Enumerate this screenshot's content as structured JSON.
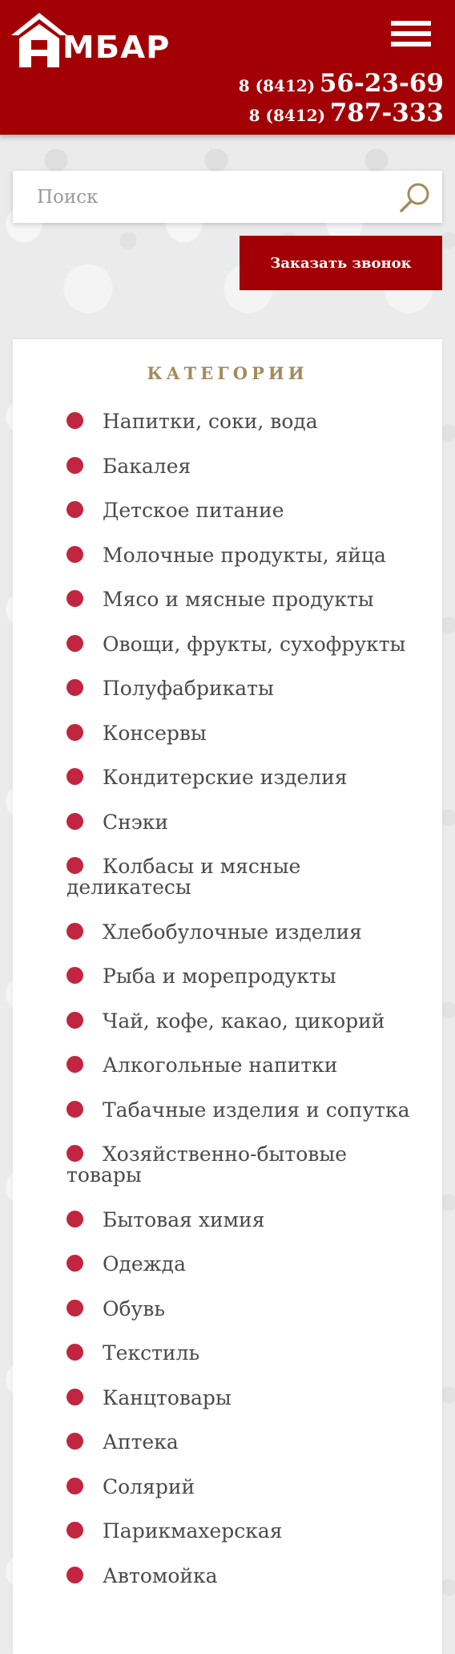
{
  "header": {
    "logo_text": "МБАР",
    "phones": [
      {
        "code": "8 (8412)",
        "number": "56-23-69"
      },
      {
        "code": "8 (8412)",
        "number": "787-333"
      }
    ]
  },
  "search": {
    "placeholder": "Поиск"
  },
  "callback": {
    "label": "Заказать звонок"
  },
  "categories": {
    "title": "КАТЕГОРИИ",
    "items": [
      "Напитки, соки, вода",
      "Бакалея",
      "Детское питание",
      "Молочные продукты, яйца",
      "Мясо и мясные продукты",
      "Овощи, фрукты, сухофрукты",
      "Полуфабрикаты",
      "Консервы",
      "Кондитерские изделия",
      "Снэки",
      "Колбасы и мясные деликатесы",
      "Хлебобулочные изделия",
      "Рыба и морепродукты",
      "Чай, кофе, какао, цикорий",
      "Алкогольные напитки",
      "Табачные изделия и сопутка",
      "Хозяйственно-бытовые товары",
      "Бытовая химия",
      "Одежда",
      "Обувь",
      "Текстиль",
      "Канцтовары",
      "Аптека",
      "Солярий",
      "Парикмахерская",
      "Автомойка"
    ]
  },
  "colors": {
    "brand_red": "#a30006",
    "bullet_red": "#c1253f",
    "title_gold": "#a38b5c"
  },
  "icons": {
    "menu": "hamburger-icon",
    "search": "magnifier-icon",
    "logo": "house-a-logo"
  }
}
